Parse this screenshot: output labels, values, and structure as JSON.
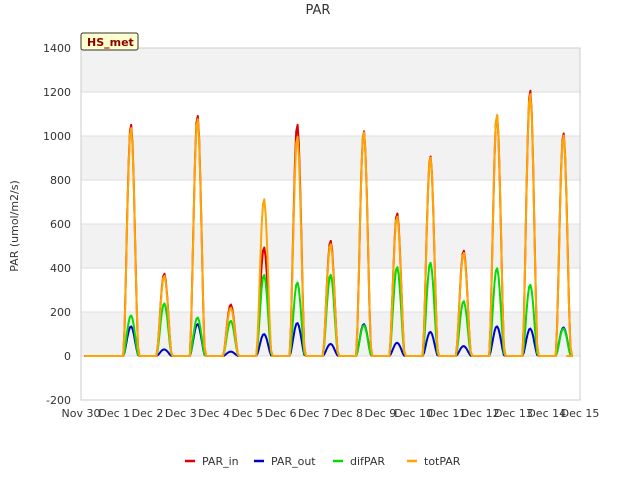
{
  "chart_data": {
    "type": "line",
    "title": "PAR",
    "ylabel": "PAR (umol/m2/s)",
    "xlabel": "",
    "badge": "HS_met",
    "ylim": [
      -200,
      1400
    ],
    "yticks": [
      -200,
      0,
      200,
      400,
      600,
      800,
      1000,
      1200,
      1400
    ],
    "xlim": [
      0,
      15
    ],
    "xticks": [
      0,
      1,
      2,
      3,
      4,
      5,
      6,
      7,
      8,
      9,
      10,
      11,
      12,
      13,
      14,
      15
    ],
    "xtick_labels": [
      "Nov 30",
      "Dec 1",
      "Dec 2",
      "Dec 3",
      "Dec 4",
      "Dec 5",
      "Dec 6",
      "Dec 7",
      "Dec 8",
      "Dec 9",
      "Dec 10",
      "Dec 11",
      "Dec 12",
      "Dec 13",
      "Dec 14",
      "Dec 15"
    ],
    "legend_position": "bottom-center",
    "grid": true,
    "background_bands": true,
    "x_unit": "days since Nov 30",
    "days": [
      0,
      1,
      2,
      3,
      4,
      5,
      6,
      7,
      8,
      9,
      10,
      11,
      12,
      13,
      14
    ],
    "series": [
      {
        "name": "PAR_in",
        "color": "#dd0000",
        "daily_peak": [
          0,
          1055,
          375,
          1095,
          235,
          495,
          1055,
          525,
          1025,
          650,
          910,
          480,
          1095,
          1210,
          1015
        ]
      },
      {
        "name": "PAR_out",
        "color": "#0000cc",
        "daily_peak": [
          0,
          135,
          30,
          145,
          20,
          100,
          150,
          55,
          145,
          60,
          110,
          45,
          135,
          125,
          130
        ]
      },
      {
        "name": "difPAR",
        "color": "#00dd00",
        "daily_peak": [
          0,
          185,
          240,
          175,
          160,
          370,
          335,
          370,
          140,
          405,
          425,
          250,
          400,
          325,
          125
        ]
      },
      {
        "name": "totPAR",
        "color": "#ffa500",
        "daily_peak": [
          0,
          1040,
          365,
          1080,
          220,
          715,
          1000,
          510,
          1020,
          635,
          905,
          470,
          1100,
          1195,
          1005
        ]
      }
    ]
  }
}
